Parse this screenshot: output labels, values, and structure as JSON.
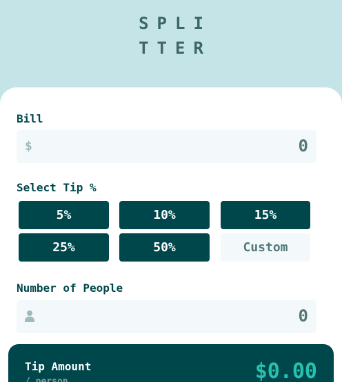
{
  "logo": {
    "line1": "SPLI",
    "line2": "TTER"
  },
  "bill": {
    "label": "Bill",
    "prefix": "$",
    "value": "0"
  },
  "tip": {
    "label": "Select Tip %",
    "options": [
      "5%",
      "10%",
      "15%",
      "25%",
      "50%"
    ],
    "custom_placeholder": "Custom"
  },
  "people": {
    "label": "Number of People",
    "icon": "person-icon",
    "value": "0"
  },
  "result": {
    "tip_label": "Tip Amount",
    "tip_sub": "/ person",
    "tip_value": "$0.00"
  },
  "colors": {
    "background": "#c5e4e7",
    "dark_cyan": "#00474b",
    "strong_cyan": "#26c2ae",
    "input_bg": "#f3f9fa"
  }
}
